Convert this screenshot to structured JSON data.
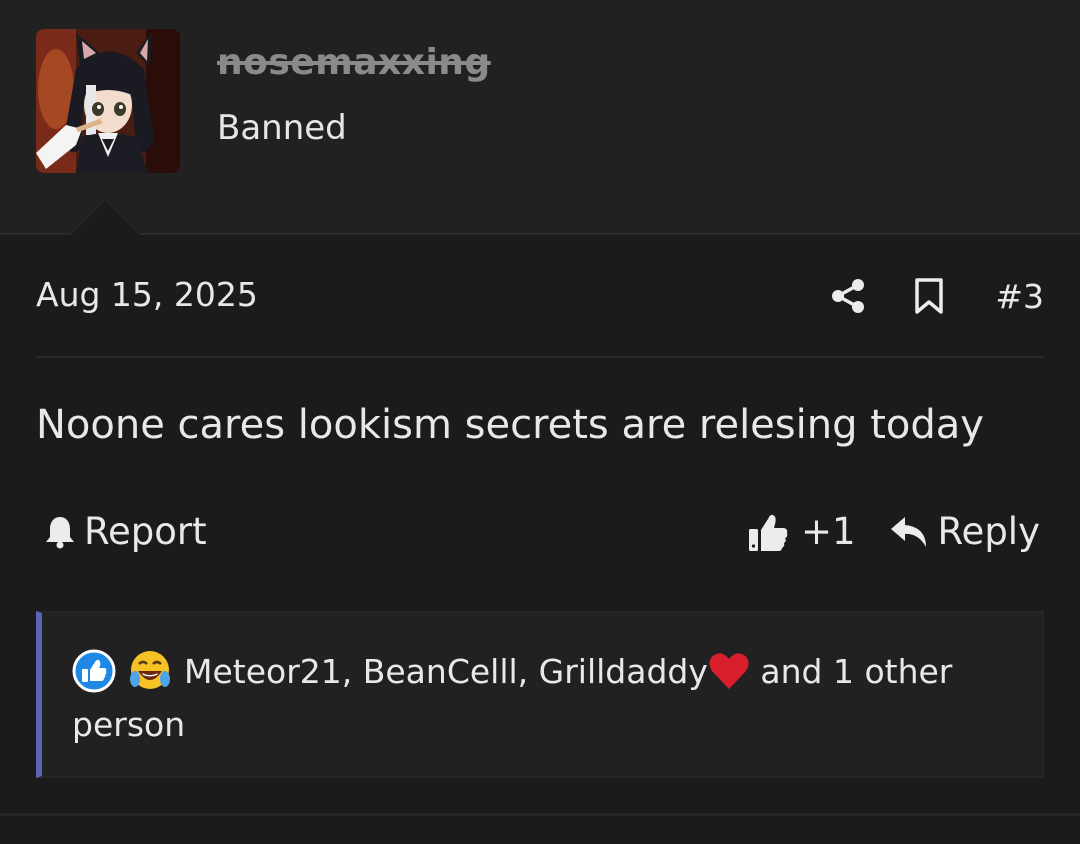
{
  "user": {
    "username": "nosemaxxing",
    "title": "Banned"
  },
  "post": {
    "date": "Aug 15, 2025",
    "number": "#3",
    "message": "Noone cares lookism secrets are relesing today"
  },
  "actions": {
    "report_label": "Report",
    "like_count": "+1",
    "reply_label": "Reply",
    "share_icon": "share-icon",
    "bookmark_icon": "bookmark-icon"
  },
  "reactions": {
    "users_text": "Meteor21, BeanCelll, Grilldaddy",
    "suffix_text": " and 1 other person",
    "accent_color": "#5a63b8",
    "like_color": "#1e88e5"
  }
}
